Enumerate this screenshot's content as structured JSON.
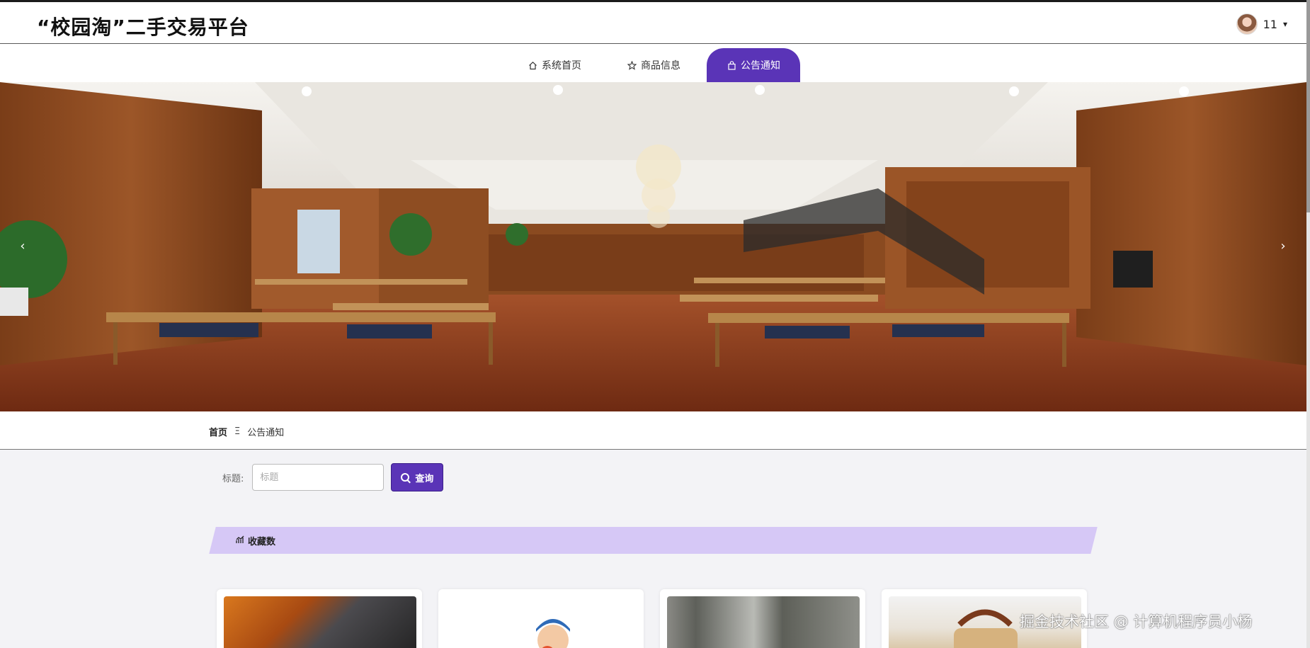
{
  "header": {
    "site_title": "“校园淘”二手交易平台",
    "user_name": "11",
    "caret": "▾"
  },
  "nav": {
    "items": [
      {
        "label": "系统首页",
        "icon": "home-icon",
        "active": false
      },
      {
        "label": "商品信息",
        "icon": "star-icon",
        "active": false
      },
      {
        "label": "公告通知",
        "icon": "shopping-bag-icon",
        "active": true
      }
    ]
  },
  "banner": {
    "prev_arrow": "‹",
    "next_arrow": "›"
  },
  "breadcrumb": {
    "home": "首页",
    "separator": "Ξ",
    "current": "公告通知"
  },
  "search": {
    "label": "标题:",
    "placeholder": "标题",
    "button_label": "查询"
  },
  "section": {
    "title": "收藏数",
    "icon": "chart-icon"
  },
  "watermark": "掘金技术社区 @ 计算机程序员小杨",
  "colors": {
    "accent": "#5a34b7",
    "section_bar": "#d6c8f6"
  }
}
